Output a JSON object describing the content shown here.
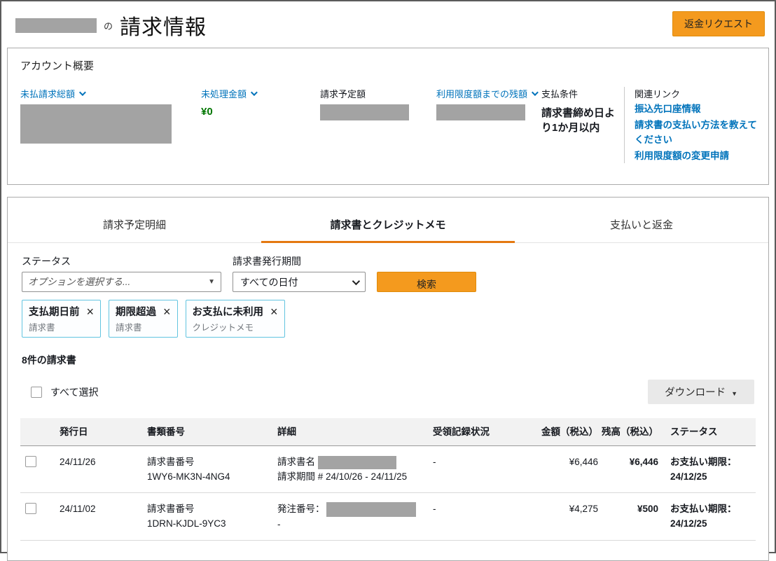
{
  "colors": {
    "accent_orange": "#f49a1e",
    "tab_underline_orange": "#e47911",
    "link_blue": "#0073bb",
    "positive_green": "#007600",
    "chip_border_blue": "#62c4e0",
    "redaction_gray": "#a3a3a3"
  },
  "header": {
    "title_connector": "の",
    "title": "請求情報",
    "refund_button_label": "返金リクエスト"
  },
  "account_overview": {
    "heading": "アカウント概要",
    "metrics": {
      "unpaid_total_label": "未払請求総額",
      "unprocessed_label": "未処理金額",
      "unprocessed_value": "¥0",
      "billed_planned_label": "請求予定額",
      "credit_remaining_label": "利用限度額までの残額"
    },
    "payment_terms": {
      "label": "支払条件",
      "value": "請求書締め日より1か月以内"
    },
    "related_links": {
      "label": "関連リンク",
      "links": [
        "振込先口座情報",
        "請求書の支払い方法を教えてください",
        "利用限度額の変更申請"
      ]
    }
  },
  "tabs": [
    {
      "label": "請求予定明細"
    },
    {
      "label": "請求書とクレジットメモ"
    },
    {
      "label": "支払いと返金"
    }
  ],
  "filters": {
    "status_label": "ステータス",
    "status_placeholder": "オプションを選択する...",
    "period_label": "請求書発行期間",
    "period_value": "すべての日付",
    "search_button_label": "検索",
    "chips": [
      {
        "title": "支払期日前",
        "subtitle": "請求書"
      },
      {
        "title": "期限超過",
        "subtitle": "請求書"
      },
      {
        "title": "お支払に未利用",
        "subtitle": "クレジットメモ"
      }
    ]
  },
  "results": {
    "count_text": "8件の請求書",
    "select_all_label": "すべて選択",
    "download_button_label": "ダウンロード",
    "table": {
      "headers": {
        "issue_date": "発行日",
        "doc_number": "書類番号",
        "detail": "詳細",
        "receipt_status": "受領記録状況",
        "amount": "金額（税込）",
        "balance": "残高（税込）",
        "status": "ステータス"
      },
      "rows": [
        {
          "issue_date": "24/11/26",
          "doc_number_label": "請求書番号",
          "doc_number": "1WY6-MK3N-4NG4",
          "detail_line1_label": "請求書名",
          "detail_line2": "請求期間 # 24/10/26 - 24/11/25",
          "receipt_status": "-",
          "amount": "¥6,446",
          "balance": "¥6,446",
          "status_line1": "お支払い期限：",
          "status_line2": "24/12/25"
        },
        {
          "issue_date": "24/11/02",
          "doc_number_label": "請求書番号",
          "doc_number": "1DRN-KJDL-9YC3",
          "detail_line1_label": "発注番号：",
          "detail_line2": "-",
          "receipt_status": "-",
          "amount": "¥4,275",
          "balance": "¥500",
          "status_line1": "お支払い期限：",
          "status_line2": "24/12/25"
        }
      ]
    }
  }
}
